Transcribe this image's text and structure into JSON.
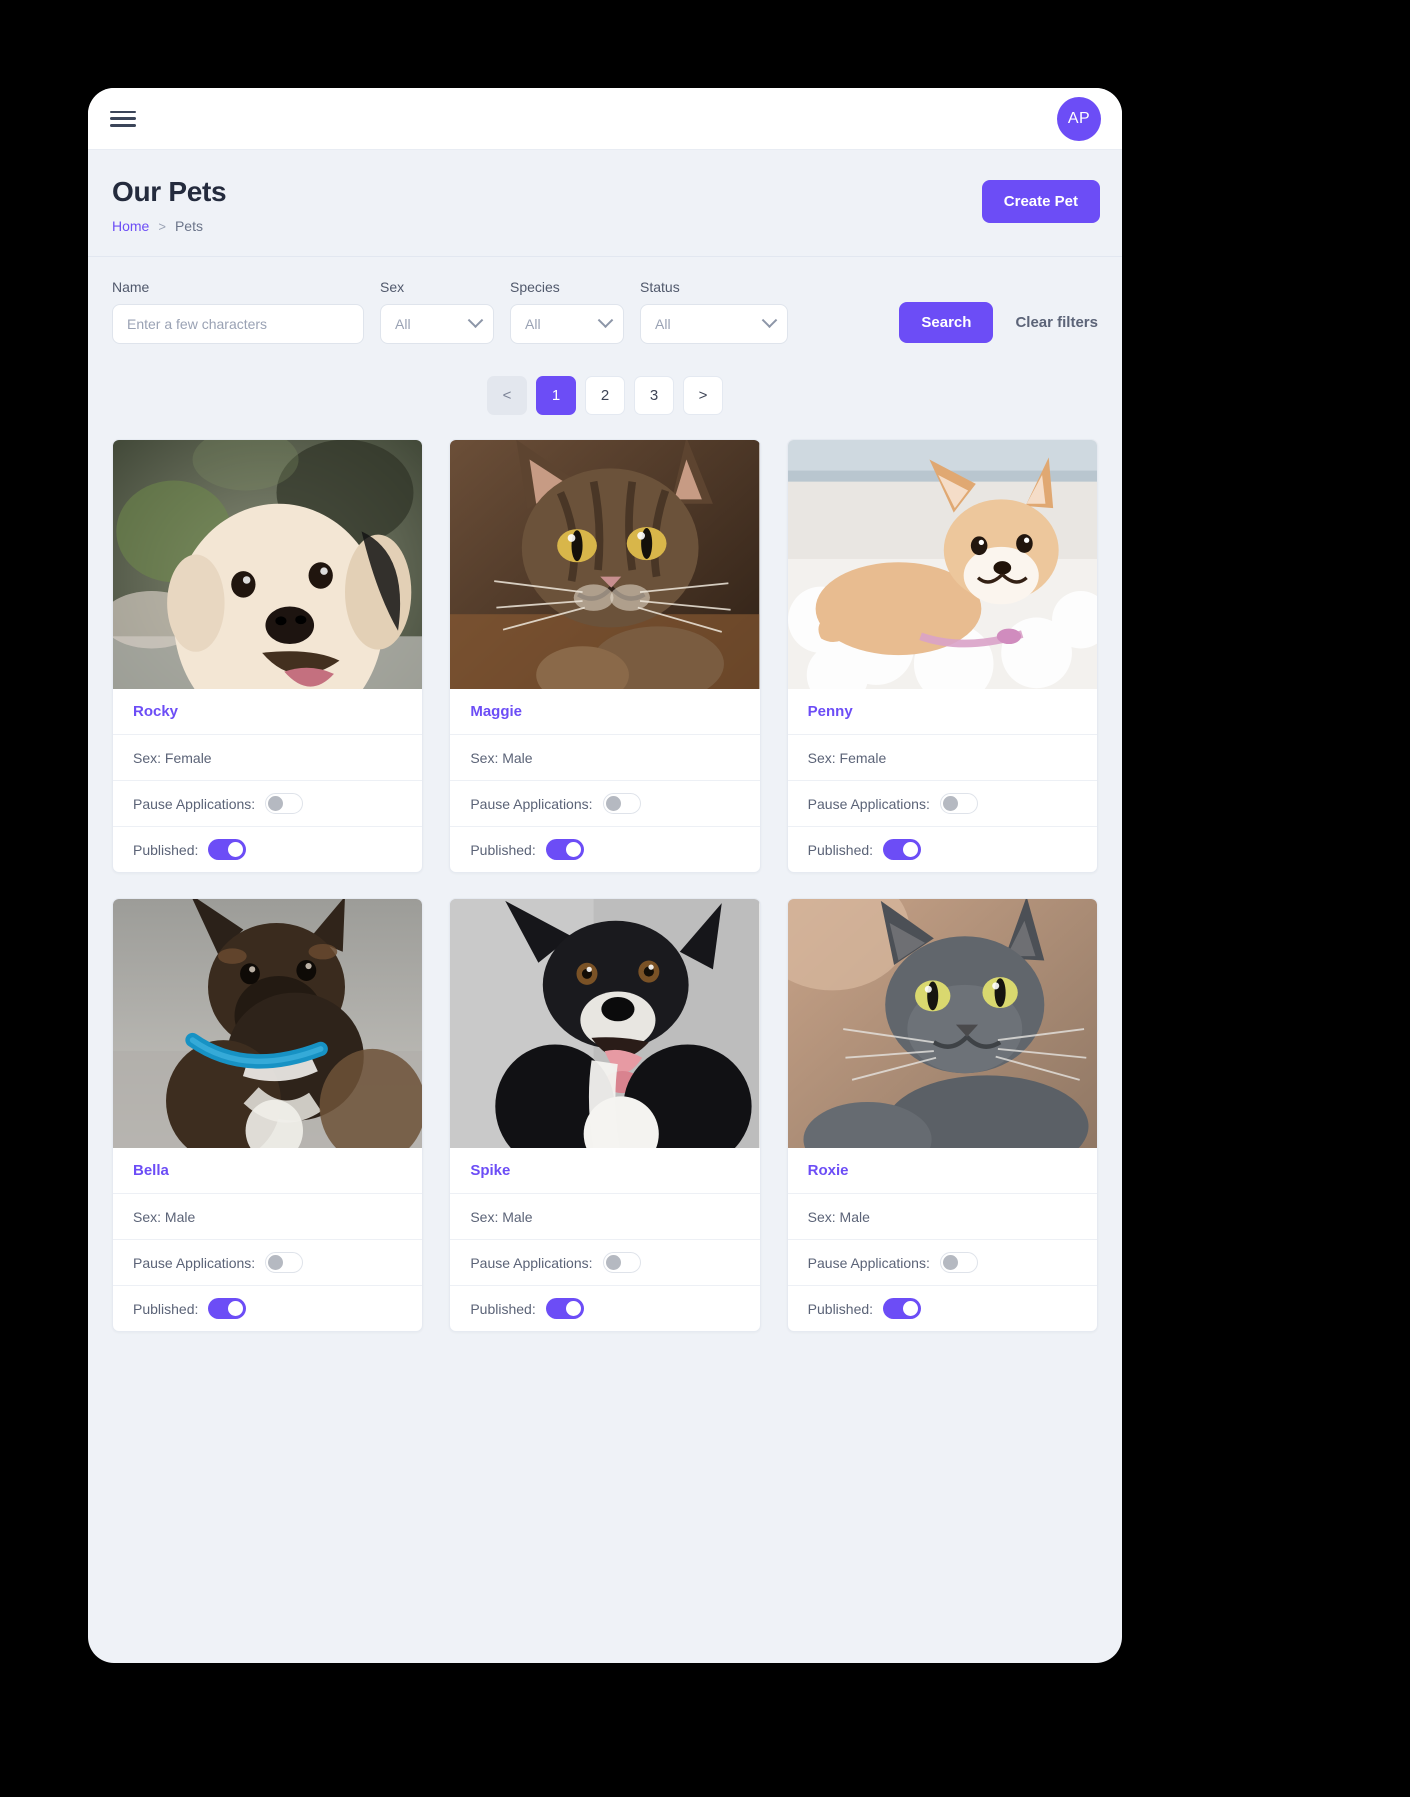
{
  "topbar": {
    "menu_icon": "hamburger-menu-icon",
    "avatar_initials": "AP"
  },
  "header": {
    "title": "Our Pets",
    "breadcrumb": {
      "home": "Home",
      "separator": ">",
      "current": "Pets"
    },
    "create_button": "Create Pet"
  },
  "filters": {
    "name": {
      "label": "Name",
      "placeholder": "Enter a few characters",
      "value": ""
    },
    "sex": {
      "label": "Sex",
      "value": "All"
    },
    "species": {
      "label": "Species",
      "value": "All"
    },
    "status": {
      "label": "Status",
      "value": "All"
    },
    "search_button": "Search",
    "clear_button": "Clear filters"
  },
  "pagination": {
    "prev": "<",
    "next": ">",
    "pages": [
      "1",
      "2",
      "3"
    ],
    "active": "1"
  },
  "labels": {
    "sex_prefix": "Sex: ",
    "pause_applications": "Pause Applications:",
    "published": "Published:"
  },
  "colors": {
    "accent": "#6c4df6",
    "page_bg": "#eff2f7",
    "card_bg": "#ffffff",
    "text": "#5b6377",
    "toggle_off": "#b5b9c1"
  },
  "pets": [
    {
      "name": "Rocky",
      "sex": "Sex: Female",
      "pause_applications": "off",
      "published": "on",
      "photo": "golden-retriever-dog-photo"
    },
    {
      "name": "Maggie",
      "sex": "Sex: Male",
      "pause_applications": "off",
      "published": "on",
      "photo": "tabby-cat-photo"
    },
    {
      "name": "Penny",
      "sex": "Sex: Female",
      "pause_applications": "off",
      "published": "on",
      "photo": "shiba-inu-puppy-photo"
    },
    {
      "name": "Bella",
      "sex": "Sex: Male",
      "pause_applications": "off",
      "published": "on",
      "photo": "brown-black-dog-blue-collar-photo"
    },
    {
      "name": "Spike",
      "sex": "Sex: Male",
      "pause_applications": "off",
      "published": "on",
      "photo": "black-white-border-collie-photo"
    },
    {
      "name": "Roxie",
      "sex": "Sex: Male",
      "pause_applications": "off",
      "published": "on",
      "photo": "grey-russian-blue-cat-photo"
    }
  ]
}
